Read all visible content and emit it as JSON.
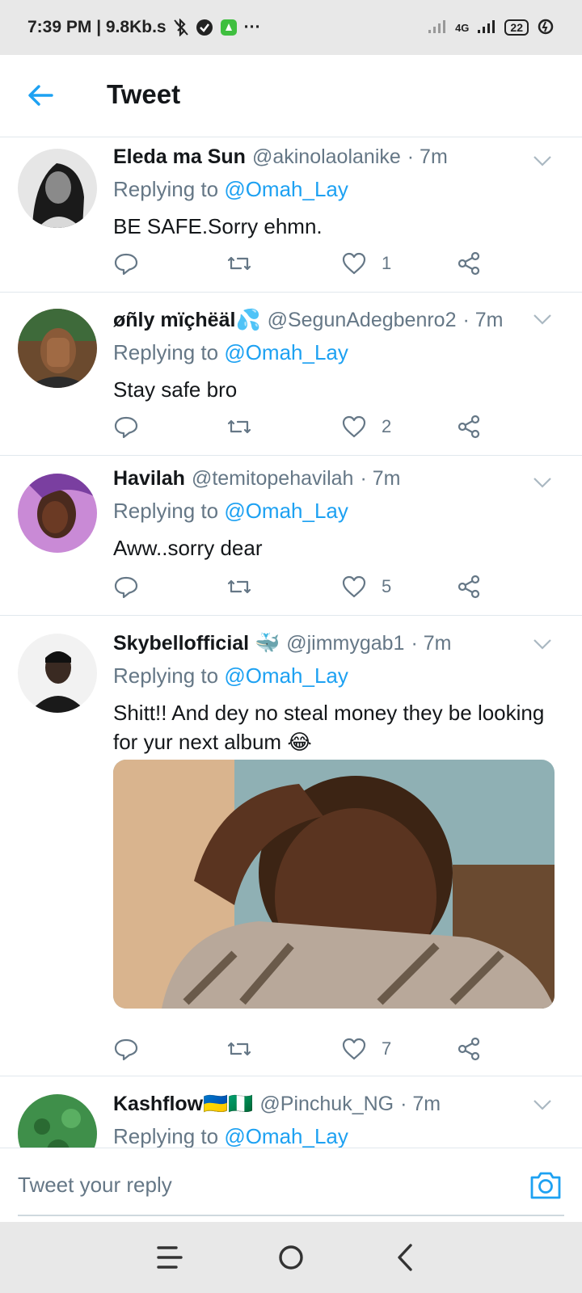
{
  "status_bar": {
    "time_speed": "7:39 PM | 9.8Kb.s",
    "more": "···",
    "network": "4G",
    "battery": "22"
  },
  "header": {
    "title": "Tweet"
  },
  "tweets": [
    {
      "name": "Eleda ma Sun",
      "handle": "@akinolaolanike",
      "time": "· 7m",
      "replying_prefix": "Replying to ",
      "replying_to": "@Omah_Lay",
      "text": "BE SAFE.Sorry ehmn.",
      "likes": "1"
    },
    {
      "name": "øñly mïçhëäl💦",
      "handle": "@SegunAdegbenro2",
      "time": "· 7m",
      "replying_prefix": "Replying to ",
      "replying_to": "@Omah_Lay",
      "text": "Stay safe bro",
      "likes": "2"
    },
    {
      "name": "Havilah",
      "handle": "@temitopehavilah",
      "time": "· 7m",
      "replying_prefix": "Replying to ",
      "replying_to": "@Omah_Lay",
      "text": "Aww..sorry dear",
      "likes": "5"
    },
    {
      "name": "Skybellofficial 🐳",
      "handle": "@jimmygab1",
      "time": "· 7m",
      "replying_prefix": "Replying to ",
      "replying_to": "@Omah_Lay",
      "text": "Shitt!! And dey no steal money they be looking for yur next album 😂",
      "likes": "7"
    },
    {
      "name": "Kashflow🇺🇦🇳🇬",
      "handle": "@Pinchuk_NG",
      "time": "· 7m",
      "replying_prefix": "Replying to ",
      "replying_to": "@Omah_Lay"
    }
  ],
  "reply": {
    "placeholder": "Tweet your reply"
  },
  "icons": {
    "back": "arrow-left-icon",
    "reply": "comment-icon",
    "retweet": "retweet-icon",
    "like": "heart-icon",
    "share": "share-icon",
    "camera": "camera-icon"
  },
  "colors": {
    "accent": "#1da1f2",
    "secondary_text": "#657786",
    "divider": "#e1e8ed"
  }
}
